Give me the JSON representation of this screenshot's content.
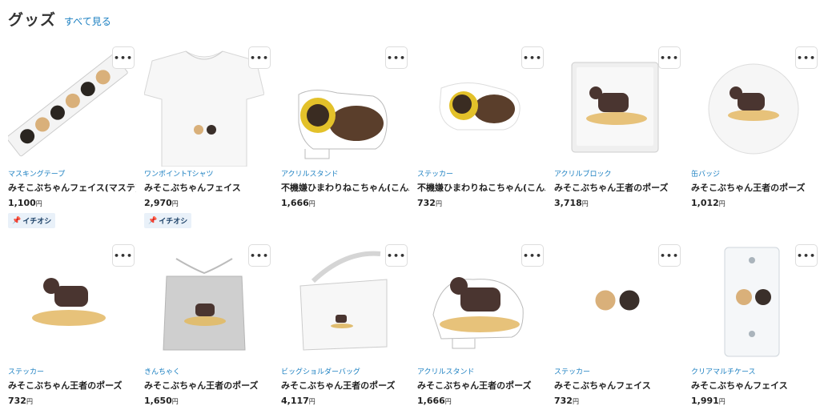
{
  "header": {
    "title": "グッズ",
    "see_all": "すべて見る"
  },
  "more_icon": "more-horizontal-icon",
  "products": [
    {
      "category": "マスキングテープ",
      "name": "みそこぶちゃんフェイス(マステ)",
      "price": "1,100",
      "currency": "円",
      "badge": "イチオシ",
      "image": "masking-tape"
    },
    {
      "category": "ワンポイントTシャツ",
      "name": "みそこぶちゃんフェイス",
      "price": "2,970",
      "currency": "円",
      "badge": "イチオシ",
      "image": "tshirt"
    },
    {
      "category": "アクリルスタンド",
      "name": "不機嫌ひまわりねこちゃん(こんぶ)",
      "price": "1,666",
      "currency": "円",
      "image": "acrylic-stand-sunflower-cat"
    },
    {
      "category": "ステッカー",
      "name": "不機嫌ひまわりねこちゃん(こんぶ)",
      "price": "732",
      "currency": "円",
      "image": "sticker-sunflower-cat"
    },
    {
      "category": "アクリルブロック",
      "name": "みそこぶちゃん王者のポーズ",
      "price": "3,718",
      "currency": "円",
      "image": "acrylic-block"
    },
    {
      "category": "缶バッジ",
      "name": "みそこぶちゃん王者のポーズ",
      "price": "1,012",
      "currency": "円",
      "image": "can-badge"
    },
    {
      "category": "ステッカー",
      "name": "みそこぶちゃん王者のポーズ",
      "price": "732",
      "currency": "円",
      "image": "sticker-king-pose"
    },
    {
      "category": "きんちゃく",
      "name": "みそこぶちゃん王者のポーズ",
      "price": "1,650",
      "currency": "円",
      "image": "drawstring-bag"
    },
    {
      "category": "ビッグショルダーバッグ",
      "name": "みそこぶちゃん王者のポーズ",
      "price": "4,117",
      "currency": "円",
      "image": "shoulder-bag"
    },
    {
      "category": "アクリルスタンド",
      "name": "みそこぶちゃん王者のポーズ",
      "price": "1,666",
      "currency": "円",
      "image": "acrylic-stand-king-pose"
    },
    {
      "category": "ステッカー",
      "name": "みそこぶちゃんフェイス",
      "price": "732",
      "currency": "円",
      "image": "sticker-face"
    },
    {
      "category": "クリアマルチケース",
      "name": "みそこぶちゃんフェイス",
      "price": "1,991",
      "currency": "円",
      "image": "clear-multi-case"
    }
  ]
}
